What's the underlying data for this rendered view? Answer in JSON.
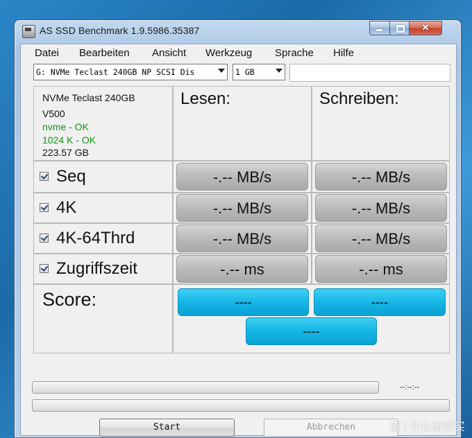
{
  "window": {
    "title": "AS SSD Benchmark 1.9.5986.35387"
  },
  "menu": [
    "Datei",
    "Bearbeiten",
    "Ansicht",
    "Werkzeug",
    "Sprache",
    "Hilfe"
  ],
  "drive_select": {
    "value": "G: NVMe Teclast 240GB NP SCSI Dis"
  },
  "size_select": {
    "value": "1 GB"
  },
  "drive_info": {
    "name": "NVMe Teclast 240GB",
    "firmware": "V500",
    "driver_status": "nvme - OK",
    "alignment_status": "1024 K - OK",
    "capacity": "223.57 GB"
  },
  "headers": {
    "read": "Lesen:",
    "write": "Schreiben:"
  },
  "tests": [
    {
      "label": "Seq",
      "checked": true,
      "read": "-.-- MB/s",
      "write": "-.-- MB/s"
    },
    {
      "label": "4K",
      "checked": true,
      "read": "-.-- MB/s",
      "write": "-.-- MB/s"
    },
    {
      "label": "4K-64Thrd",
      "checked": true,
      "read": "-.-- MB/s",
      "write": "-.-- MB/s"
    },
    {
      "label": "Zugriffszeit",
      "checked": true,
      "read": "-.-- ms",
      "write": "-.-- ms"
    }
  ],
  "score": {
    "label": "Score:",
    "read": "----",
    "write": "----",
    "total": "----"
  },
  "progress": {
    "time": "--:--:--",
    "fraction": 0
  },
  "buttons": {
    "start": "Start",
    "cancel": "Abbrechen"
  },
  "watermark": "值 | 什么值得买",
  "colors": {
    "score_accent": "#15b6e6",
    "ok_status": "#149414"
  }
}
